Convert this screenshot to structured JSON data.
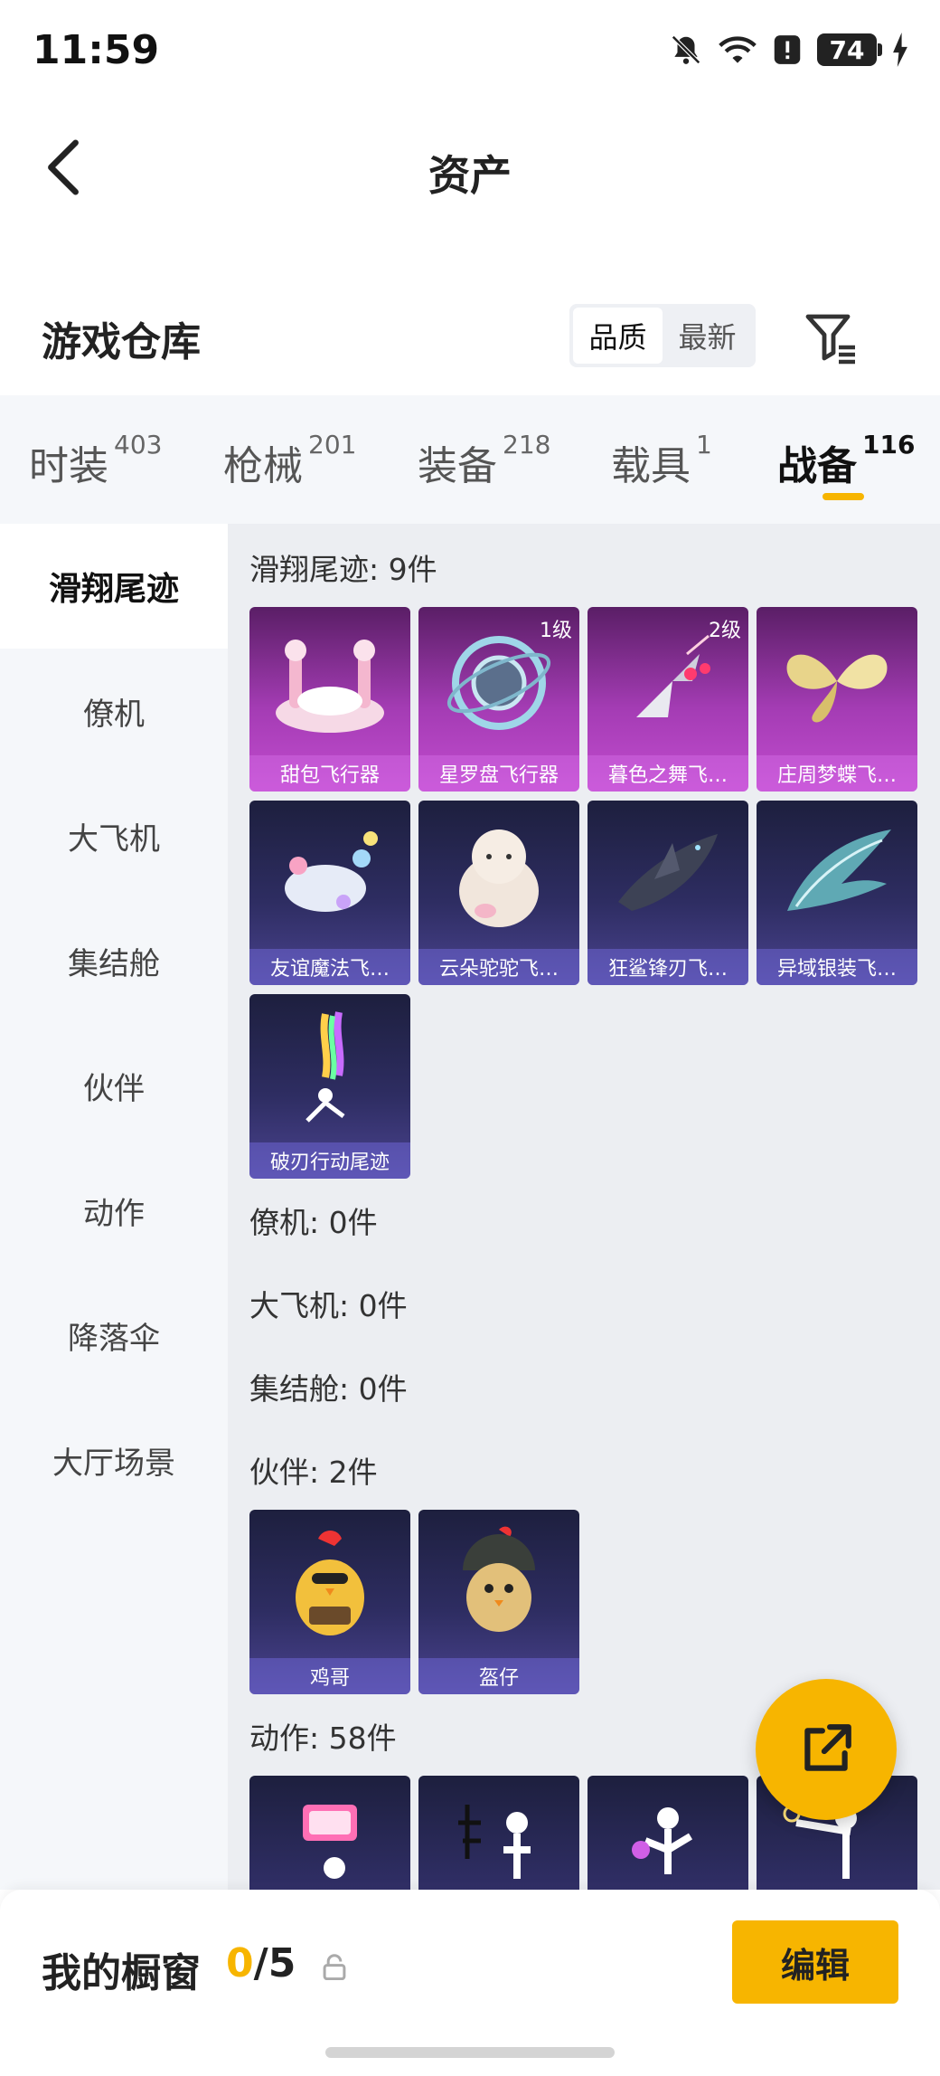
{
  "status_bar": {
    "time": "11:59",
    "battery": "74"
  },
  "nav": {
    "title": "资产"
  },
  "warehouse": {
    "title": "游戏仓库",
    "sort_options": [
      "品质",
      "最新"
    ],
    "sort_selected": "品质"
  },
  "tabs": [
    {
      "label": "时装",
      "count": "403"
    },
    {
      "label": "枪械",
      "count": "201"
    },
    {
      "label": "装备",
      "count": "218"
    },
    {
      "label": "载具",
      "count": "1"
    },
    {
      "label": "战备",
      "count": "116"
    }
  ],
  "active_tab": "战备",
  "sidebar": {
    "items": [
      "滑翔尾迹",
      "僚机",
      "大飞机",
      "集结舱",
      "伙伴",
      "动作",
      "降落伞",
      "大厅场景"
    ],
    "active": "滑翔尾迹"
  },
  "sections": {
    "glide_trail": {
      "title": "滑翔尾迹: 9件",
      "items": [
        {
          "name": "甜包飞行器",
          "level": "",
          "icon": "dessert-glider-icon",
          "rarity": "purple"
        },
        {
          "name": "星罗盘飞行器",
          "level": "1级",
          "icon": "astrolabe-glider-icon",
          "rarity": "purple"
        },
        {
          "name": "暮色之舞飞…",
          "level": "2级",
          "icon": "twilight-dance-glider-icon",
          "rarity": "purple"
        },
        {
          "name": "庄周梦蝶飞…",
          "level": "",
          "icon": "butterfly-glider-icon",
          "rarity": "purple"
        },
        {
          "name": "友谊魔法飞…",
          "level": "",
          "icon": "friendship-magic-glider-icon",
          "rarity": "blue"
        },
        {
          "name": "云朵驼驼飞…",
          "level": "",
          "icon": "alpaca-glider-icon",
          "rarity": "blue"
        },
        {
          "name": "狂鲨锋刃飞…",
          "level": "",
          "icon": "shark-blade-glider-icon",
          "rarity": "blue"
        },
        {
          "name": "异域银装飞…",
          "level": "",
          "icon": "silver-wing-glider-icon",
          "rarity": "blue"
        },
        {
          "name": "破刃行动尾迹",
          "level": "",
          "icon": "smoke-trail-icon",
          "rarity": "blue"
        }
      ]
    },
    "wingman": {
      "title": "僚机: 0件"
    },
    "big_plane": {
      "title": "大飞机: 0件"
    },
    "capsule": {
      "title": "集结舱: 0件"
    },
    "partner": {
      "title": "伙伴: 2件",
      "items": [
        {
          "name": "鸡哥",
          "icon": "chicken-partner-icon",
          "rarity": "blue"
        },
        {
          "name": "盔仔",
          "icon": "helmet-chick-partner-icon",
          "rarity": "blue"
        }
      ]
    },
    "emote": {
      "title": "动作: 58件",
      "items": [
        {
          "icon": "emote-sign-icon"
        },
        {
          "icon": "emote-calligraphy-icon"
        },
        {
          "icon": "emote-dance-icon"
        },
        {
          "icon": "emote-pose-icon"
        }
      ]
    }
  },
  "bottom_bar": {
    "title": "我的橱窗",
    "count_current": "0",
    "count_total": "/5",
    "edit_label": "编辑"
  },
  "colors": {
    "accent": "#f7b500",
    "purple_card": "#a43cb4",
    "blue_card": "#2e2d62"
  }
}
